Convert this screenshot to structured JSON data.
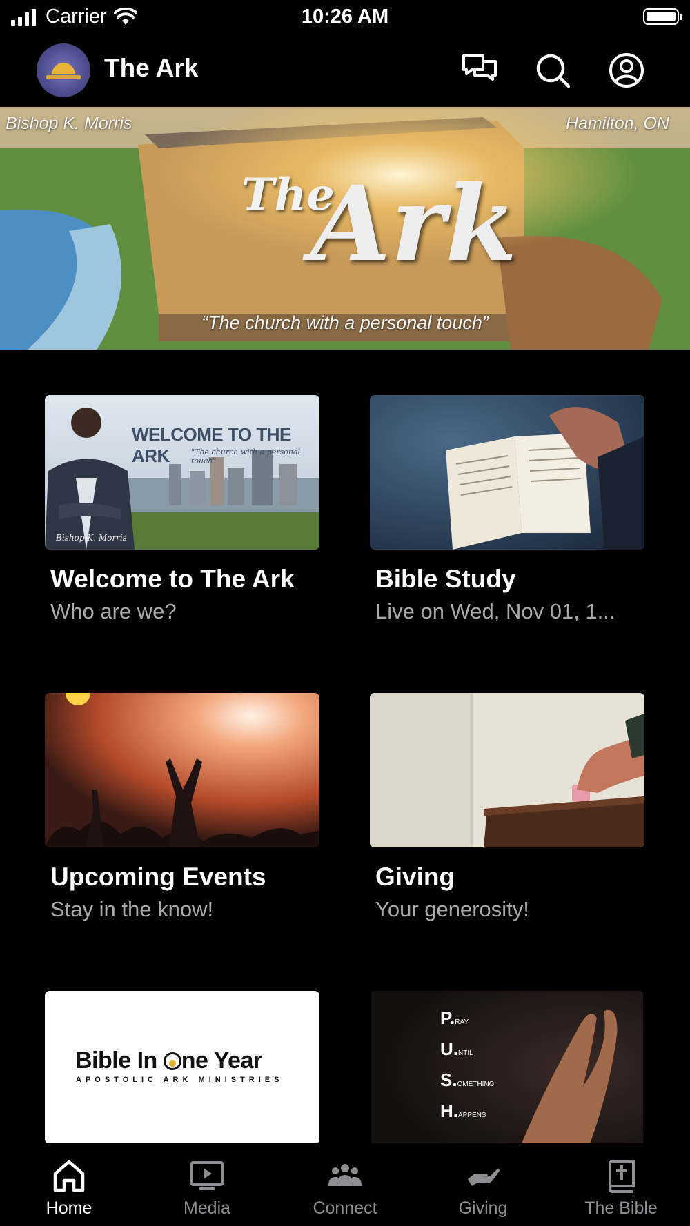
{
  "status_bar": {
    "carrier": "Carrier",
    "time": "10:26 AM"
  },
  "header": {
    "app_title": "The Ark",
    "icons": [
      "chat-icon",
      "search-icon",
      "profile-icon"
    ]
  },
  "hero": {
    "left_caption": "Bishop K. Morris",
    "right_caption": "Hamilton, ON",
    "logo_small": "The",
    "logo_large": "Ark",
    "tagline": "“The church with a personal touch”"
  },
  "cards": [
    {
      "title": "Welcome to The Ark",
      "subtitle": "Who are we?",
      "image_text": "WELCOME TO THE ARK",
      "image_tagline": "\"The church with a personal touch\"",
      "image_signature": "Bishop K. Morris"
    },
    {
      "title": "Bible Study",
      "subtitle": "Live on Wed, Nov 01, 1..."
    },
    {
      "title": "Upcoming Events",
      "subtitle": "Stay in the know!"
    },
    {
      "title": "Giving",
      "subtitle": "Your generosity!"
    },
    {
      "title": "",
      "subtitle": "",
      "image_text_before": "Bible In ",
      "image_text_after": "ne Year",
      "image_subtext": "APOSTOLIC ARK MINISTRIES"
    },
    {
      "title": "",
      "subtitle": "",
      "push_lines": [
        {
          "letter": "P.",
          "rest": "RAY"
        },
        {
          "letter": "U.",
          "rest": "NTIL"
        },
        {
          "letter": "S.",
          "rest": "OMETHING"
        },
        {
          "letter": "H.",
          "rest": "APPENS"
        }
      ]
    }
  ],
  "tab_bar": {
    "tabs": [
      {
        "label": "Home",
        "icon": "home-icon",
        "active": true
      },
      {
        "label": "Media",
        "icon": "media-icon",
        "active": false
      },
      {
        "label": "Connect",
        "icon": "connect-icon",
        "active": false
      },
      {
        "label": "Giving",
        "icon": "giving-icon",
        "active": false
      },
      {
        "label": "The Bible",
        "icon": "bible-icon",
        "active": false
      }
    ]
  },
  "colors": {
    "background": "#000000",
    "text_primary": "#ffffff",
    "text_secondary": "#a9a9a9",
    "tab_inactive": "#8e8e93"
  }
}
